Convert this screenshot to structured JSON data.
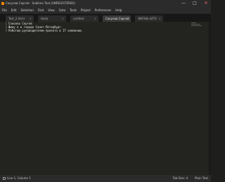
{
  "window": {
    "title": "Сокулов Сергей - Sublime Text (UNREGISTERED)",
    "controls": {
      "minimize": "—",
      "maximize": "□",
      "close": "✕"
    }
  },
  "menu": [
    "File",
    "Edit",
    "Selection",
    "Find",
    "View",
    "Goto",
    "Tools",
    "Project",
    "Preferences",
    "Help"
  ],
  "tabs": [
    {
      "label": "Test_2.html",
      "active": false
    },
    {
      "label": "Hello",
      "active": false
    },
    {
      "label": "untitled",
      "active": false
    },
    {
      "label": "Сокулов Сергей",
      "active": true
    },
    {
      "label": "ЖИЗНЬ ШТО",
      "active": false
    }
  ],
  "editor": {
    "line_numbers": [
      "1",
      "2",
      "3"
    ],
    "lines": [
      "Соколов Сергей",
      "Живу я в городе Санкт-Петербург.",
      "Работаю руководителем проекта в IT компании."
    ]
  },
  "status": {
    "left": "Line 1, Column 1",
    "tab_size": "Tab Size: 4",
    "syntax": "Plain Text"
  },
  "colors": {
    "editor_bg": "#23241f",
    "chrome_bg": "#2b2b2b",
    "text": "#e6e6e6",
    "gutter_text": "#8f908a"
  }
}
